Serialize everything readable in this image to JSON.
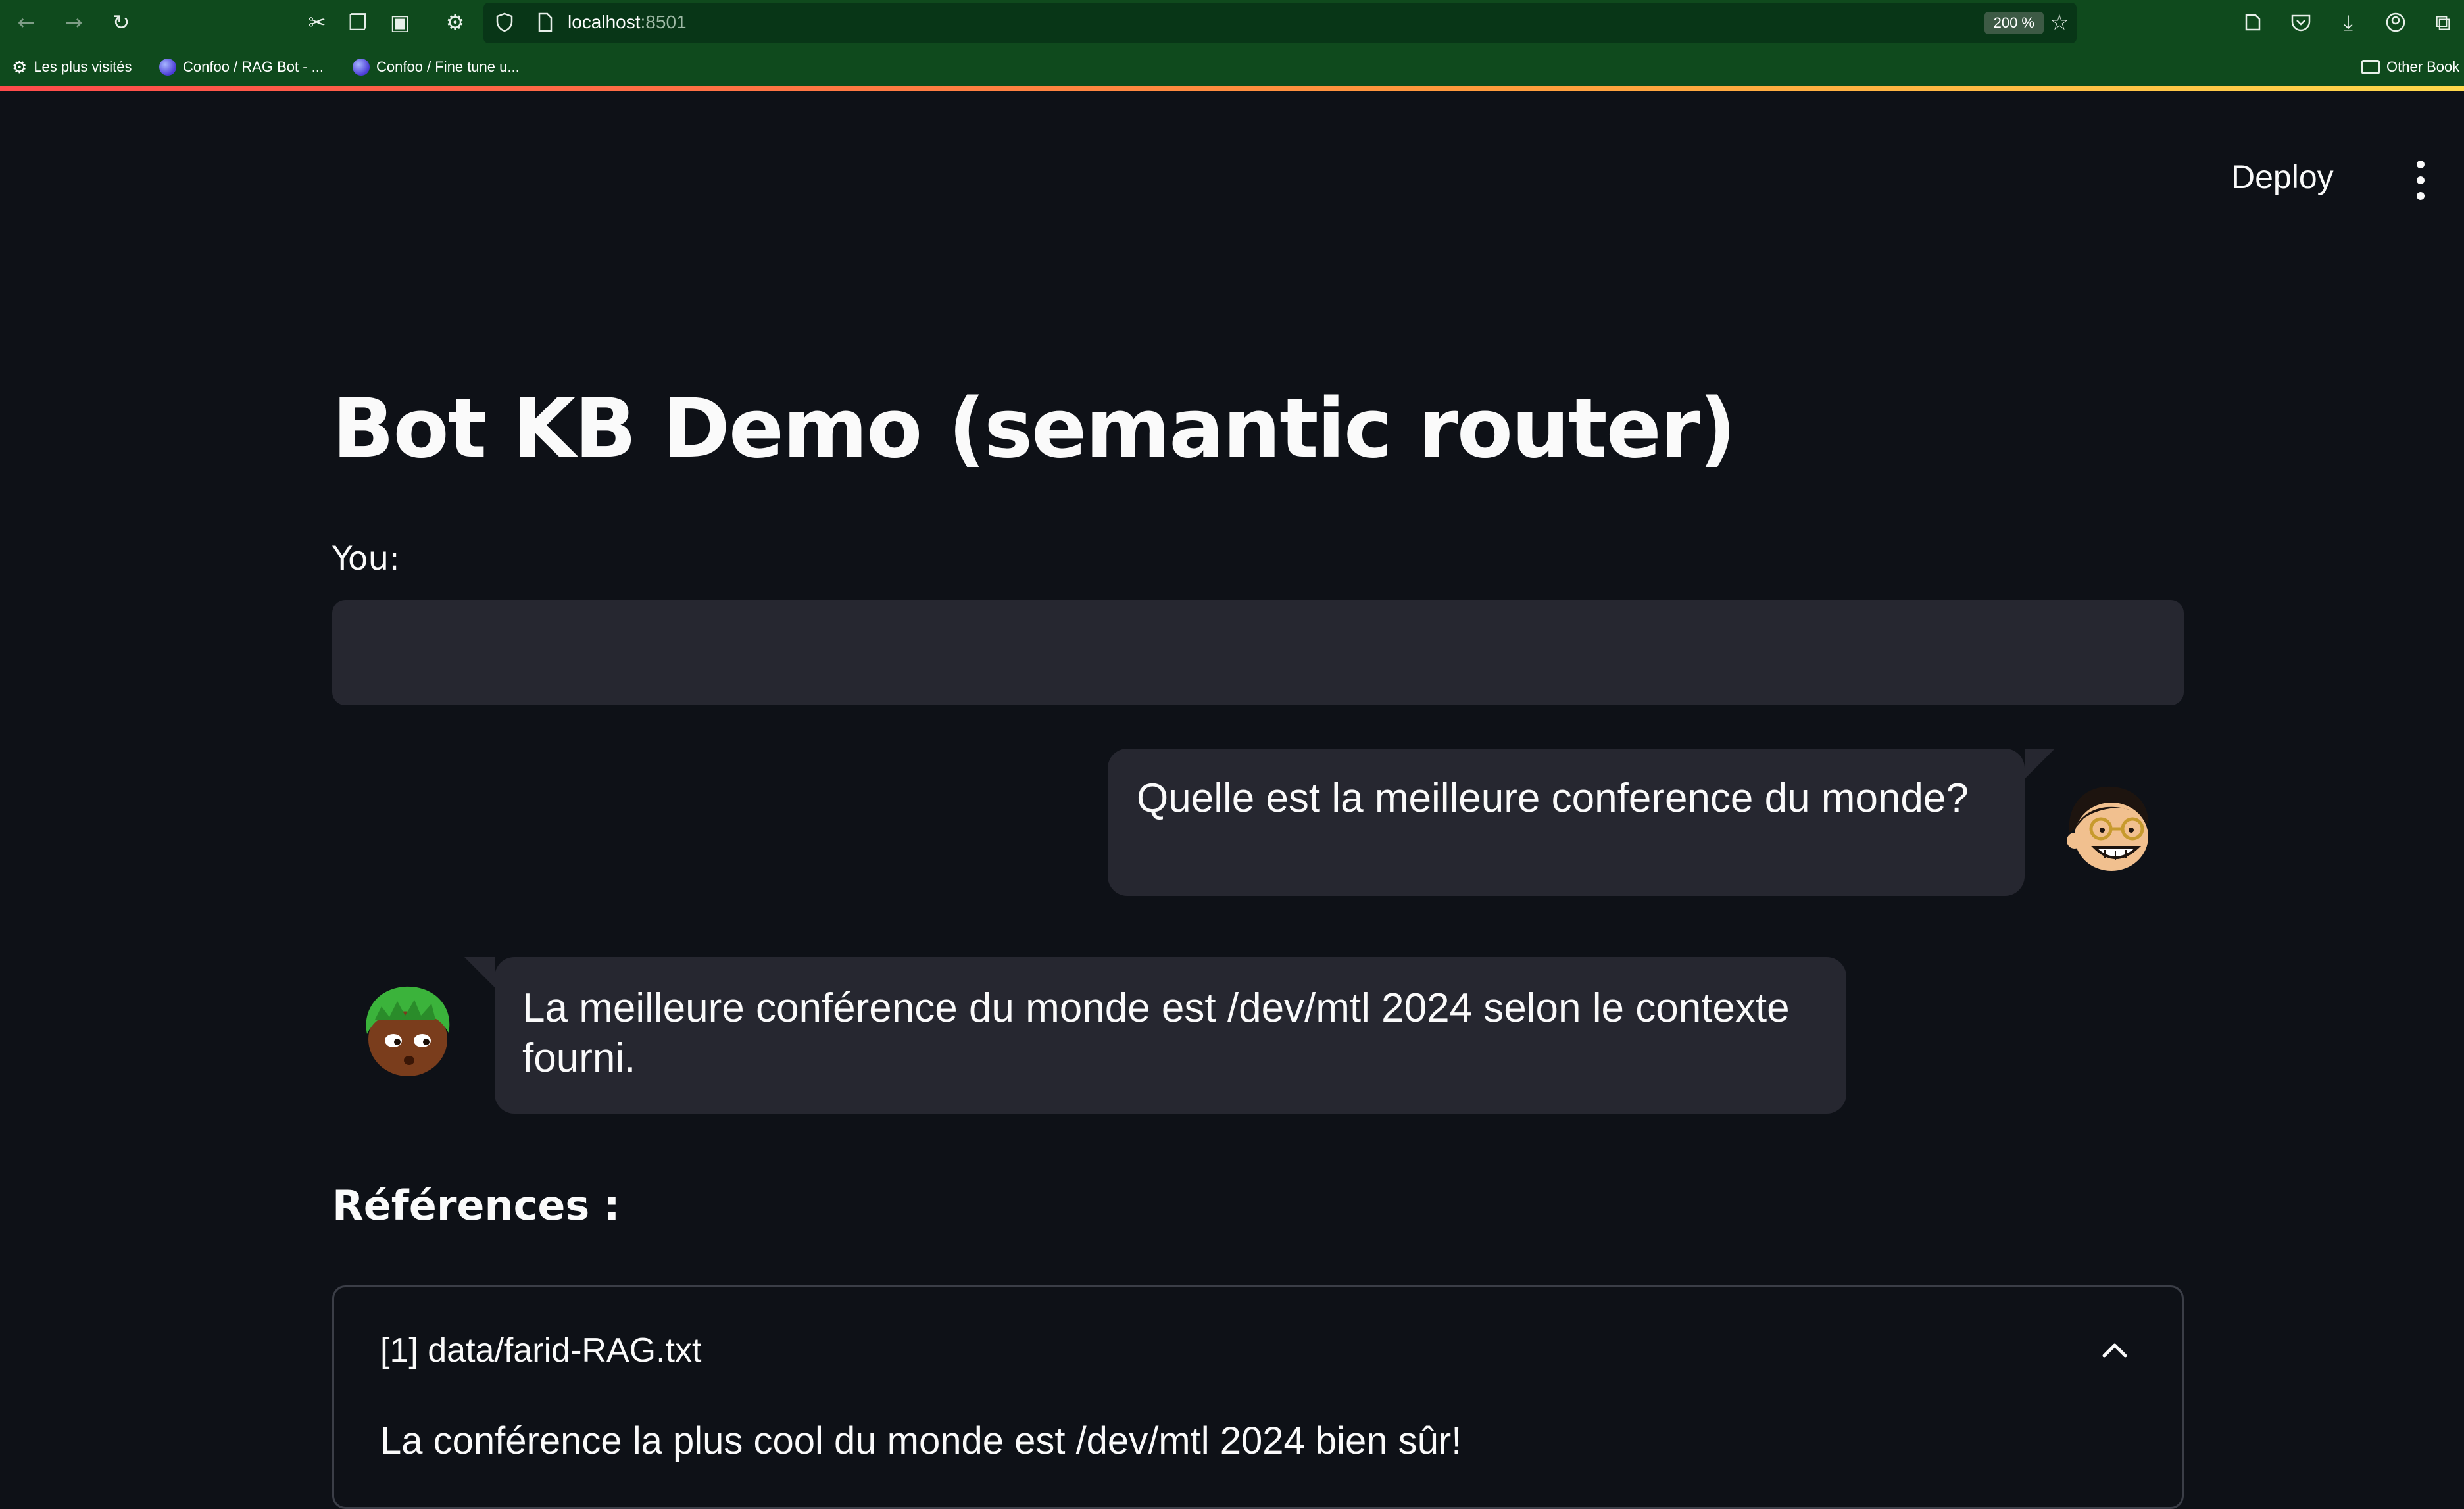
{
  "browser": {
    "url_host": "localhost",
    "url_port": ":8501",
    "zoom": "200 %",
    "bookmarks": [
      {
        "label": "Les plus visités"
      },
      {
        "label": "Confoo / RAG Bot - ..."
      },
      {
        "label": "Confoo / Fine tune u..."
      }
    ],
    "other_bookmarks": "Other Book",
    "icons": [
      "back-icon",
      "forward-icon",
      "reload-icon",
      "cut-icon",
      "copy-icon",
      "paste-icon",
      "settings-icon",
      "shield-icon",
      "page-icon",
      "star-icon",
      "pocket-icon",
      "save-icon",
      "download-icon",
      "account-icon",
      "extensions-icon"
    ]
  },
  "header": {
    "deploy_label": "Deploy",
    "menu_icon": "kebab-menu-icon"
  },
  "main": {
    "title": "Bot KB Demo (semantic router)",
    "input_label": "You:",
    "input_value": "",
    "messages": [
      {
        "role": "user",
        "text": "Quelle est la meilleure conference du monde?"
      },
      {
        "role": "bot",
        "text": "La meilleure conférence du monde est /dev/mtl 2024 selon le contexte fourni."
      }
    ],
    "references_heading": "Références :",
    "references": [
      {
        "title": "[1] data/farid-RAG.txt",
        "content": "La conférence la plus cool du monde est /dev/mtl 2024 bien sûr!",
        "expanded": true
      }
    ]
  },
  "colors": {
    "background": "#0e1117",
    "surface": "#262730",
    "chrome": "#0f4a1d",
    "accent_gradient": [
      "#ff4b4b",
      "#ff9a3c",
      "#ffd84b"
    ]
  }
}
